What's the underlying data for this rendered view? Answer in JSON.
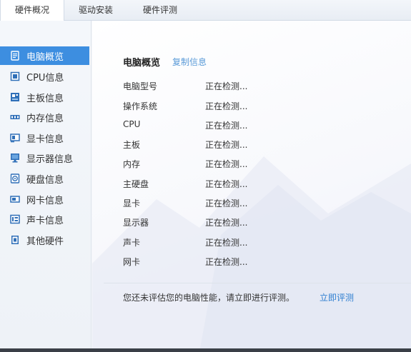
{
  "tabs": [
    {
      "label": "硬件概况",
      "active": true
    },
    {
      "label": "驱动安装",
      "active": false
    },
    {
      "label": "硬件评测",
      "active": false
    }
  ],
  "sidebar": {
    "items": [
      {
        "label": "电脑概览",
        "icon": "computer-overview-icon",
        "active": true
      },
      {
        "label": "CPU信息",
        "icon": "cpu-icon",
        "active": false
      },
      {
        "label": "主板信息",
        "icon": "motherboard-icon",
        "active": false
      },
      {
        "label": "内存信息",
        "icon": "memory-icon",
        "active": false
      },
      {
        "label": "显卡信息",
        "icon": "graphics-card-icon",
        "active": false
      },
      {
        "label": "显示器信息",
        "icon": "monitor-icon",
        "active": false
      },
      {
        "label": "硬盘信息",
        "icon": "hard-disk-icon",
        "active": false
      },
      {
        "label": "网卡信息",
        "icon": "network-card-icon",
        "active": false
      },
      {
        "label": "声卡信息",
        "icon": "sound-card-icon",
        "active": false
      },
      {
        "label": "其他硬件",
        "icon": "other-hardware-icon",
        "active": false
      }
    ]
  },
  "overview": {
    "title": "电脑概览",
    "copy_label": "复制信息",
    "rows": [
      {
        "label": "电脑型号",
        "value": "正在检测..."
      },
      {
        "label": "操作系统",
        "value": "正在检测..."
      },
      {
        "label": "CPU",
        "value": "正在检测..."
      },
      {
        "label": "主板",
        "value": "正在检测..."
      },
      {
        "label": "内存",
        "value": "正在检测..."
      },
      {
        "label": "主硬盘",
        "value": "正在检测..."
      },
      {
        "label": "显卡",
        "value": "正在检测..."
      },
      {
        "label": "显示器",
        "value": "正在检测..."
      },
      {
        "label": "声卡",
        "value": "正在检测..."
      },
      {
        "label": "网卡",
        "value": "正在检测..."
      }
    ]
  },
  "footer": {
    "notice": "您还未评估您的电脑性能，请立即进行评测。",
    "eval_link": "立即评测"
  },
  "colors": {
    "accent": "#3d8ee0",
    "link": "#2f7fd1",
    "icon_blue": "#2f6fb8"
  }
}
